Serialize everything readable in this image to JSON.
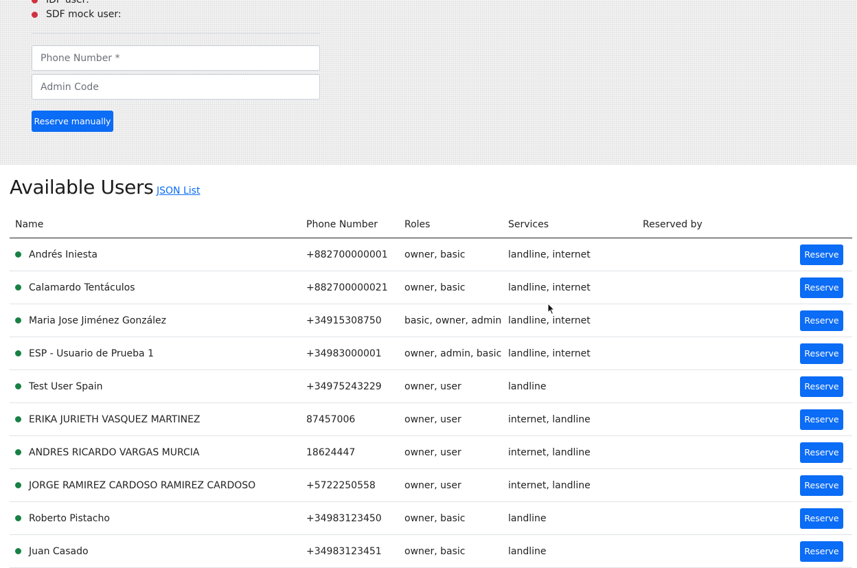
{
  "status_list": [
    {
      "label": "IDP user:"
    },
    {
      "label": "SDF mock user:"
    }
  ],
  "form": {
    "phone_placeholder": "Phone Number *",
    "admin_placeholder": "Admin Code",
    "reserve_manually_label": "Reserve manually"
  },
  "users_section": {
    "title": "Available Users",
    "json_link": "JSON List",
    "columns": [
      "Name",
      "Phone Number",
      "Roles",
      "Services",
      "Reserved by"
    ],
    "reserve_label": "Reserve",
    "rows": [
      {
        "name": "Andrés Iniesta",
        "phone": "+882700000001",
        "roles": "owner, basic",
        "services": "landline, internet",
        "reserved_by": ""
      },
      {
        "name": "Calamardo Tentáculos",
        "phone": "+882700000021",
        "roles": "owner, basic",
        "services": "landline, internet",
        "reserved_by": ""
      },
      {
        "name": "Maria Jose Jiménez González",
        "phone": "+34915308750",
        "roles": "basic, owner, admin",
        "services": "landline, internet",
        "reserved_by": ""
      },
      {
        "name": "ESP - Usuario de Prueba 1",
        "phone": "+34983000001",
        "roles": "owner, admin, basic",
        "services": "landline, internet",
        "reserved_by": ""
      },
      {
        "name": "Test User Spain",
        "phone": "+34975243229",
        "roles": "owner, user",
        "services": "landline",
        "reserved_by": ""
      },
      {
        "name": "ERIKA JURIETH VASQUEZ MARTINEZ",
        "phone": "87457006",
        "roles": "owner, user",
        "services": "internet, landline",
        "reserved_by": ""
      },
      {
        "name": "ANDRES RICARDO VARGAS MURCIA",
        "phone": "18624447",
        "roles": "owner, user",
        "services": "internet, landline",
        "reserved_by": ""
      },
      {
        "name": "JORGE RAMIREZ CARDOSO RAMIREZ CARDOSO",
        "phone": "+5722250558",
        "roles": "owner, user",
        "services": "internet, landline",
        "reserved_by": ""
      },
      {
        "name": "Roberto Pistacho",
        "phone": "+34983123450",
        "roles": "owner, basic",
        "services": "landline",
        "reserved_by": ""
      },
      {
        "name": "Juan Casado",
        "phone": "+34983123451",
        "roles": "owner, basic",
        "services": "landline",
        "reserved_by": ""
      }
    ]
  },
  "colors": {
    "accent": "#0b6cf5",
    "available_dot": "#178144",
    "status_dot": "#d0323f"
  }
}
